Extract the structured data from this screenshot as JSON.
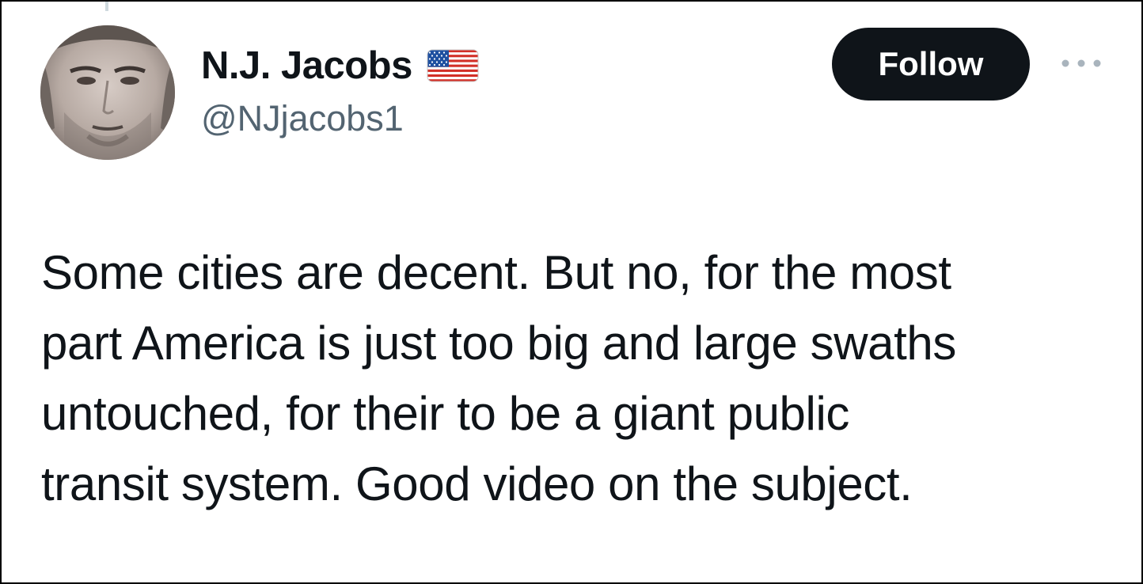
{
  "tweet": {
    "author": {
      "display_name": "N.J. Jacobs",
      "handle": "@NJjacobs1",
      "avatar": "avatar-photo",
      "badge_icon": "us-flag-emoji"
    },
    "follow_label": "Follow",
    "more_icon": "more-options-icon",
    "text_lines": [
      "Some cities are decent. But no, for the most",
      "part America is just too big and large swaths",
      "untouched, for their to be a giant public",
      "transit system. Good video on the subject."
    ]
  },
  "colors": {
    "text_primary": "#0f1419",
    "text_secondary": "#536471",
    "button_bg": "#0f1419",
    "button_text": "#ffffff",
    "icon_muted": "#a9b4bd"
  }
}
